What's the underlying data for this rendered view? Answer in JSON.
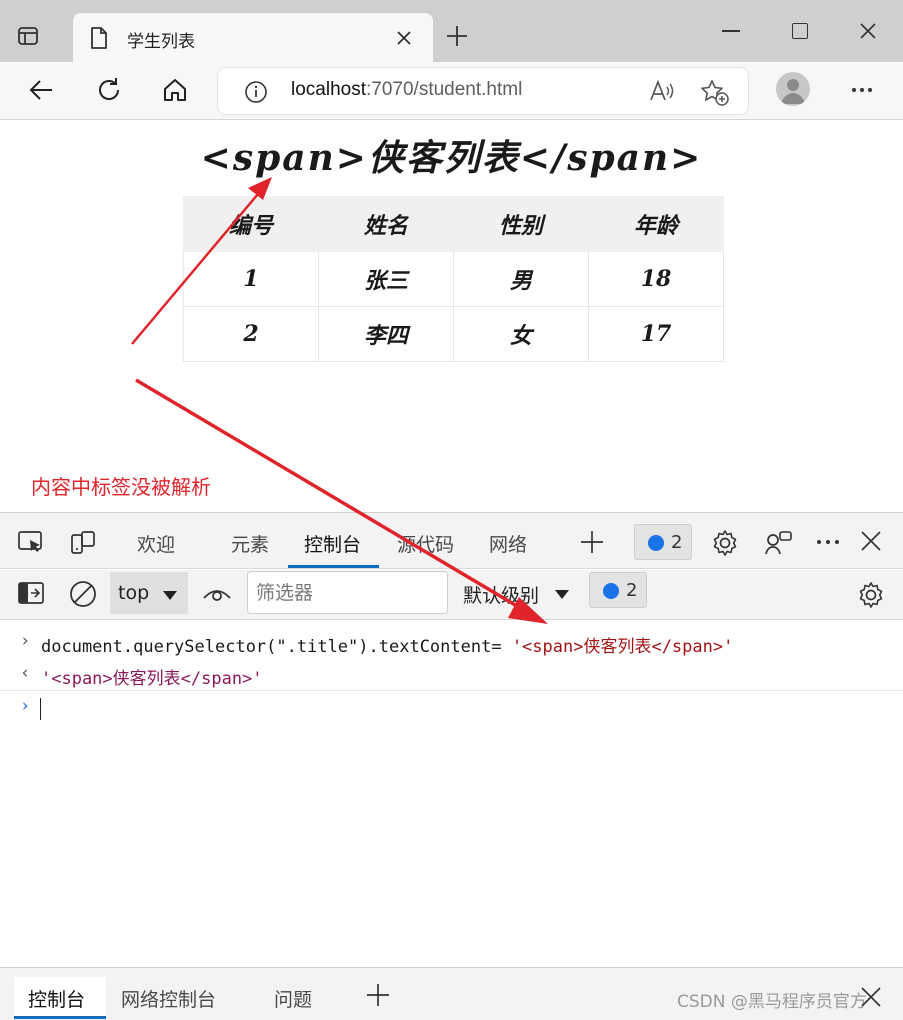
{
  "browser": {
    "tab_title": "学生列表",
    "url_host": "localhost",
    "url_path": ":7070/student.html"
  },
  "page": {
    "heading": "<span>侠客列表</span>",
    "table": {
      "headers": [
        "编号",
        "姓名",
        "性别",
        "年龄"
      ],
      "rows": [
        [
          "1",
          "张三",
          "男",
          "18"
        ],
        [
          "2",
          "李四",
          "女",
          "17"
        ]
      ]
    }
  },
  "annotation": {
    "label": "内容中标签没被解析",
    "color": "#e0242c"
  },
  "devtools": {
    "tabs": {
      "welcome": "欢迎",
      "elements": "元素",
      "console": "控制台",
      "sources": "源代码",
      "network": "网络"
    },
    "issues_count": "2",
    "context": "top",
    "filter_placeholder": "筛选器",
    "levels": "默认级别",
    "filter_issues_count": "2",
    "console": {
      "input_code": "document.querySelector(\".title\").textContent= ",
      "input_string": "'<span>侠客列表</span>'",
      "result": "'<span>侠客列表</span>'"
    },
    "drawer": {
      "console": "控制台",
      "network_console": "网络控制台",
      "issues": "问题"
    }
  },
  "watermark": "CSDN @黑马程序员官方"
}
